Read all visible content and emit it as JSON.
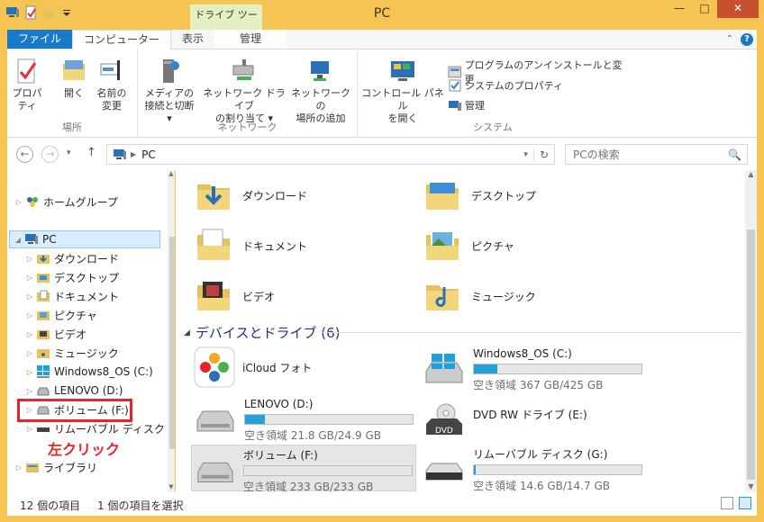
{
  "window": {
    "title": "PC",
    "context_tab_title": "ドライブ ツール"
  },
  "tabs": {
    "file": "ファイル",
    "computer": "コンピューター",
    "view": "表示",
    "manage": "管理"
  },
  "ribbon": {
    "location": {
      "label": "場所",
      "properties": "プロパティ",
      "open": "開く",
      "rename_l1": "名前の",
      "rename_l2": "変更"
    },
    "network": {
      "label": "ネットワーク",
      "media_l1": "メディアの",
      "media_l2": "接続と切断",
      "mapdrive_l1": "ネットワーク ドライブ",
      "mapdrive_l2": "の割り当て",
      "addloc_l1": "ネットワークの",
      "addloc_l2": "場所の追加"
    },
    "system": {
      "label": "システム",
      "control_l1": "コントロール パネル",
      "control_l2": "を開く",
      "uninstall": "プログラムのアンインストールと変更",
      "sysprops": "システムのプロパティ",
      "manage": "管理"
    }
  },
  "address": {
    "path": "PC",
    "search_placeholder": "PCの検索"
  },
  "nav": {
    "homegroup": "ホームグループ",
    "pc": "PC",
    "items": [
      "ダウンロード",
      "デスクトップ",
      "ドキュメント",
      "ピクチャ",
      "ビデオ",
      "ミュージック",
      "Windows8_OS (C:)",
      "LENOVO (D:)",
      "ボリューム (F:)",
      "リムーバブル ディスク (G:)"
    ],
    "library": "ライブラリ"
  },
  "annotation": "左クリック",
  "folders": [
    "ダウンロード",
    "デスクトップ",
    "ドキュメント",
    "ピクチャ",
    "ビデオ",
    "ミュージック"
  ],
  "section": "デバイスとドライブ (6)",
  "drives": [
    {
      "name": "iCloud フォト"
    },
    {
      "name": "Windows8_OS (C:)",
      "free": "空き領域 367 GB/425 GB",
      "used_fraction": 0.14
    },
    {
      "name": "LENOVO (D:)",
      "free": "空き領域 21.8 GB/24.9 GB",
      "used_fraction": 0.12
    },
    {
      "name": "DVD RW ドライブ (E:)"
    },
    {
      "name": "ボリューム (F:)",
      "free": "空き領域 233 GB/233 GB",
      "used_fraction": 0.0
    },
    {
      "name": "リムーバブル ディスク (G:)",
      "free": "空き領域 14.6 GB/14.7 GB",
      "used_fraction": 0.01
    }
  ],
  "status": {
    "count": "12 個の項目",
    "selected": "1 個の項目を選択"
  },
  "colors": {
    "accent": "#1979ca",
    "frame": "#f6c453",
    "highlight": "#e8242b",
    "usage": "#26a0da"
  }
}
